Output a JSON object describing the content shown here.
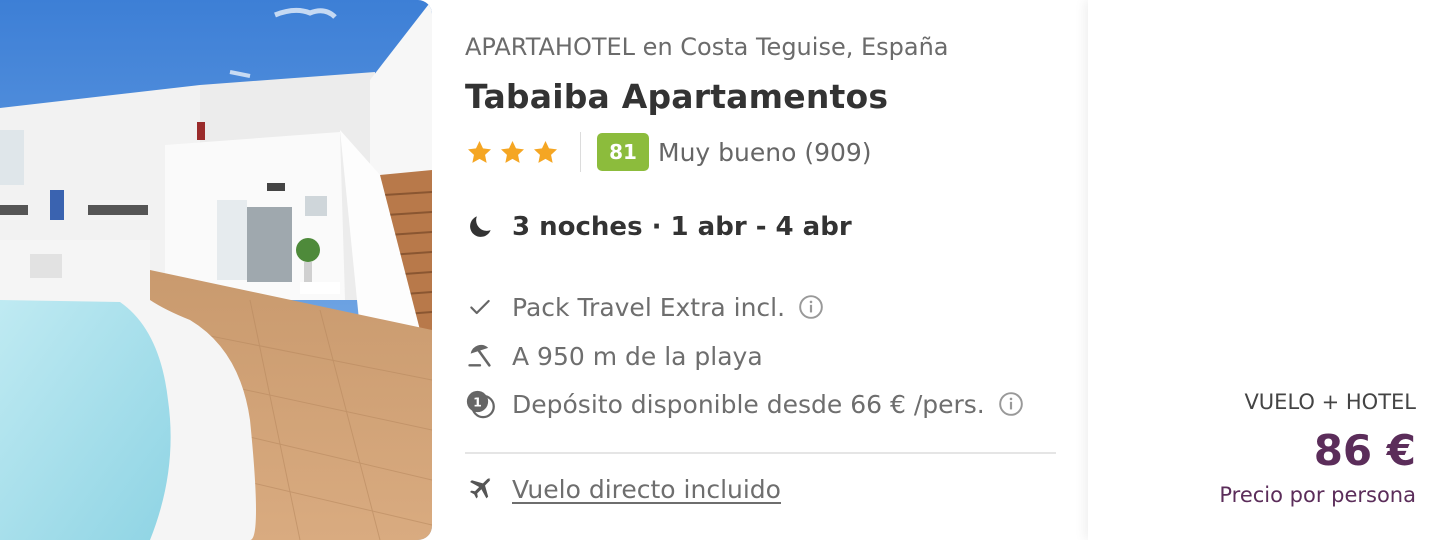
{
  "hotel": {
    "category_location": "APARTAHOTEL en Costa Teguise, España",
    "name": "Tabaiba Apartamentos",
    "stars": 3,
    "score": "81",
    "score_text": "Muy bueno (909)"
  },
  "stay": {
    "summary": "3 noches · 1 abr - 4 abr"
  },
  "features": [
    {
      "icon": "check-icon",
      "label": "Pack Travel Extra incl.",
      "has_info": true
    },
    {
      "icon": "beach-umbrella-icon",
      "label": "A 950 m de la playa",
      "has_info": false
    },
    {
      "icon": "deposit-coin-icon",
      "label": "Depósito disponible desde 66 € /pers.",
      "has_info": true
    }
  ],
  "flight": {
    "label": "Vuelo directo incluido"
  },
  "price": {
    "type_label": "VUELO + HOTEL",
    "amount": "86 €",
    "per_person": "Precio por persona"
  },
  "colors": {
    "score_badge": "#8cbc3c",
    "star": "#f5a623",
    "price": "#5b2d5a"
  }
}
